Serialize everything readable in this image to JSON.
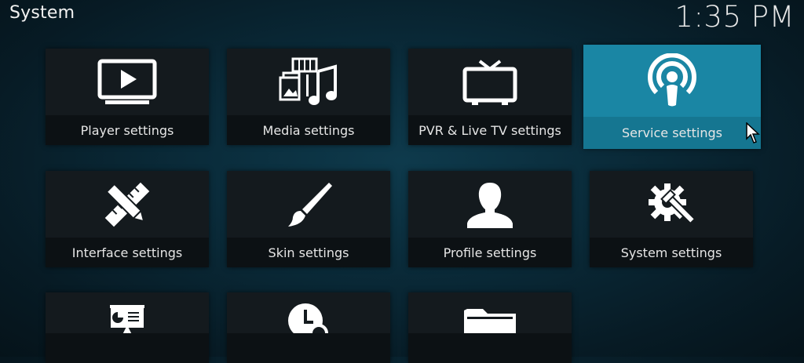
{
  "header": {
    "title": "System",
    "clock": "1:35 PM"
  },
  "tiles": [
    {
      "label": "Player settings",
      "icon": "monitor-play-icon"
    },
    {
      "label": "Media settings",
      "icon": "media-icon"
    },
    {
      "label": "PVR & Live TV settings",
      "icon": "tv-icon"
    },
    {
      "label": "Service settings",
      "icon": "podcast-icon",
      "focused": true
    },
    {
      "label": "Interface settings",
      "icon": "ruler-pencil-icon"
    },
    {
      "label": "Skin settings",
      "icon": "paintbrush-icon"
    },
    {
      "label": "Profile settings",
      "icon": "user-icon"
    },
    {
      "label": "System settings",
      "icon": "gear-wrench-icon"
    },
    {
      "label": "",
      "icon": "presentation-icon"
    },
    {
      "label": "",
      "icon": "clock-search-icon"
    },
    {
      "label": "",
      "icon": "folder-icon"
    }
  ],
  "colors": {
    "focus": "#1a86a4",
    "tile": "#141a1e",
    "label_bg": "#0c1114"
  }
}
